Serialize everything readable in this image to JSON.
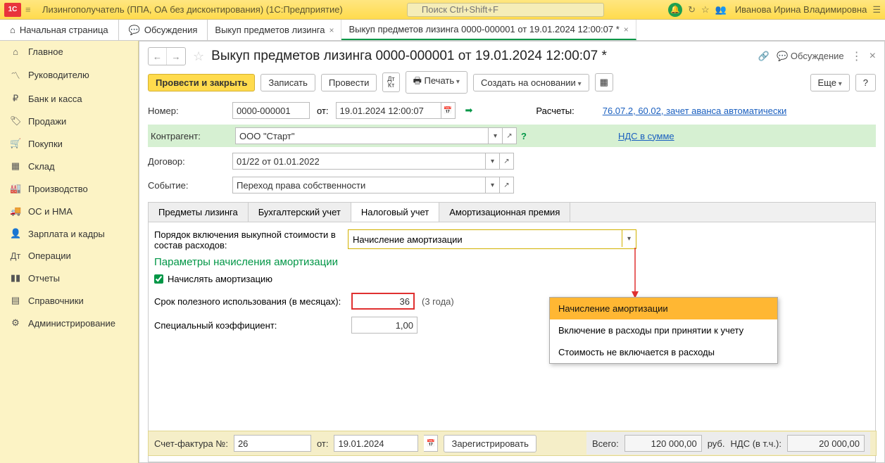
{
  "titlebar": {
    "app_title": "Лизингополучатель (ППА, ОА без дисконтирования)  (1С:Предприятие)",
    "search_placeholder": "Поиск Ctrl+Shift+F",
    "user": "Иванова Ирина Владимировна"
  },
  "main_tabs": {
    "home": "Начальная страница",
    "discussions": "Обсуждения",
    "tab_a": "Выкуп предметов лизинга",
    "tab_b": "Выкуп предметов лизинга 0000-000001 от 19.01.2024 12:00:07 *"
  },
  "sidebar": {
    "items": [
      "Главное",
      "Руководителю",
      "Банк и касса",
      "Продажи",
      "Покупки",
      "Склад",
      "Производство",
      "ОС и НМА",
      "Зарплата и кадры",
      "Операции",
      "Отчеты",
      "Справочники",
      "Администрирование"
    ]
  },
  "doc": {
    "title": "Выкуп предметов лизинга 0000-000001 от 19.01.2024 12:00:07 *",
    "discussion": "Обсуждение"
  },
  "toolbar": {
    "post_close": "Провести и закрыть",
    "save": "Записать",
    "post": "Провести",
    "dtkt": "Дт\nКт",
    "print": "Печать",
    "create_based": "Создать на основании",
    "more": "Еще",
    "help": "?"
  },
  "form": {
    "number_label": "Номер:",
    "number": "0000-000001",
    "from_label": "от:",
    "date": "19.01.2024 12:00:07",
    "settlements_label": "Расчеты:",
    "settlements_link": "76.07.2, 60.02, зачет аванса автоматически",
    "counterparty_label": "Контрагент:",
    "counterparty": "ООО \"Старт\"",
    "vat_link": "НДС в сумме",
    "contract_label": "Договор:",
    "contract": "01/22 от 01.01.2022",
    "event_label": "Событие:",
    "event": "Переход права собственности"
  },
  "inner_tabs": {
    "t1": "Предметы лизинга",
    "t2": "Бухгалтерский учет",
    "t3": "Налоговый учет",
    "t4": "Амортизационная премия"
  },
  "tax": {
    "order_label": "Порядок включения выкупной стоимости в состав расходов:",
    "order_value": "Начисление амортизации",
    "params_title": "Параметры начисления амортизации",
    "accrue_label": "Начислять амортизацию",
    "useful_life_label": "Срок полезного использования (в месяцах):",
    "useful_life": "36",
    "useful_life_hint": "(3 года)",
    "coeff_label": "Специальный коэффициент:",
    "coeff": "1,00"
  },
  "dropdown": {
    "opt1": "Начисление амортизации",
    "opt2": "Включение в расходы при принятии к учету",
    "opt3": "Стоимость не включается в расходы"
  },
  "footer": {
    "invoice_label": "Счет-фактура №:",
    "invoice_no": "26",
    "from": "от:",
    "invoice_date": "19.01.2024",
    "register": "Зарегистрировать",
    "total_label": "Всего:",
    "total": "120 000,00",
    "currency": "руб.",
    "vat_label": "НДС (в т.ч.):",
    "vat": "20 000,00"
  }
}
